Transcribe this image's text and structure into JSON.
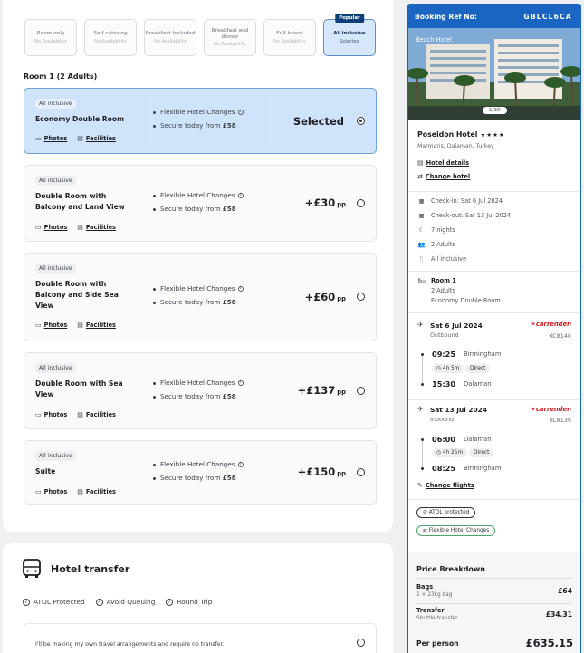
{
  "boards": [
    {
      "name": "Room only",
      "availability": "No Availability",
      "selected": false
    },
    {
      "name": "Self catering",
      "availability": "No Availability",
      "selected": false
    },
    {
      "name": "Breakfast included",
      "availability": "No Availability",
      "selected": false
    },
    {
      "name": "Breakfast and dinner",
      "availability": "No Availability",
      "selected": false
    },
    {
      "name": "Full board",
      "availability": "No Availability",
      "selected": false
    },
    {
      "name": "All inclusive",
      "availability": "Selected",
      "selected": true,
      "badge": "Popular"
    }
  ],
  "room_heading": "Room 1 (2 Adults)",
  "room_links": {
    "photos": "Photos",
    "facilities": "Facilities"
  },
  "features": {
    "flexible": "Flexible Hotel Changes",
    "secure": "Secure today from",
    "secure_amount": "£58"
  },
  "rooms": [
    {
      "tag": "All inclusive",
      "name": "Economy Double Room",
      "price": "Selected",
      "unit": "",
      "selected": true
    },
    {
      "tag": "All inclusive",
      "name": "Double Room with Balcony and Land View",
      "price": "+£30",
      "unit": "pp",
      "selected": false
    },
    {
      "tag": "All inclusive",
      "name": "Double Room with Balcony and Side Sea View",
      "price": "+£60",
      "unit": "pp",
      "selected": false
    },
    {
      "tag": "All inclusive",
      "name": "Double Room with Sea View",
      "price": "+£137",
      "unit": "pp",
      "selected": false
    },
    {
      "tag": "All inclusive",
      "name": "Suite",
      "price": "+£150",
      "unit": "pp",
      "selected": false
    }
  ],
  "transfer": {
    "title": "Hotel transfer",
    "features": [
      "ATOL Protected",
      "Avoid Queuing",
      "Round Trip"
    ],
    "no_transfer": "I'll be making my own travel arrangements and require no transfer."
  },
  "summary": {
    "booking_ref_label": "Booking Ref No:",
    "booking_ref": "GBLCL6CA",
    "image_tag": "Beach Hotel",
    "image_count": "1/30",
    "hotel_name": "Poseidon Hotel",
    "stars": "★★★★",
    "location": "Marmaris, Dalaman, Turkey",
    "hotel_details": "Hotel details",
    "change_hotel": "Change hotel",
    "check_in": "Check-in: Sat 6 Jul 2024",
    "check_out": "Check-out: Sat 13 Jul 2024",
    "nights": "7 nights",
    "adults": "2 Adults",
    "board": "All inclusive",
    "room_label": "Room 1",
    "room_guests": "2 Adults",
    "room_type": "Economy Double Room",
    "outbound": {
      "date": "Sat 6 Jul 2024",
      "dir": "Outbound",
      "airline": "carrenden",
      "flight": "XC8140",
      "dep_time": "09:25",
      "dep_place": "Birmingham",
      "duration": "4h 5m",
      "stops": "Direct",
      "arr_time": "15:30",
      "arr_place": "Dalaman"
    },
    "inbound": {
      "date": "Sat 13 Jul 2024",
      "dir": "Inbound",
      "airline": "carrenden",
      "flight": "XC8139",
      "dep_time": "06:00",
      "dep_place": "Dalaman",
      "duration": "4h 25m",
      "stops": "Direct",
      "arr_time": "08:25",
      "arr_place": "Birmingham"
    },
    "change_flights": "Change flights",
    "badges": [
      "ATOL protected",
      "Flexible Hotel Changes"
    ]
  },
  "price_breakdown": {
    "title": "Price Breakdown",
    "rows": [
      {
        "label": "Bags",
        "sub": "1 × 23kg bag",
        "value": "£64"
      },
      {
        "label": "Transfer",
        "sub": "Shuttle transfer",
        "value": "£34.31"
      }
    ],
    "total_label": "Per person",
    "total": "£635.15"
  },
  "colors": {
    "brand": "#1a64c2",
    "selected_bg": "#cfe3fb",
    "airline": "#d11a1f"
  }
}
